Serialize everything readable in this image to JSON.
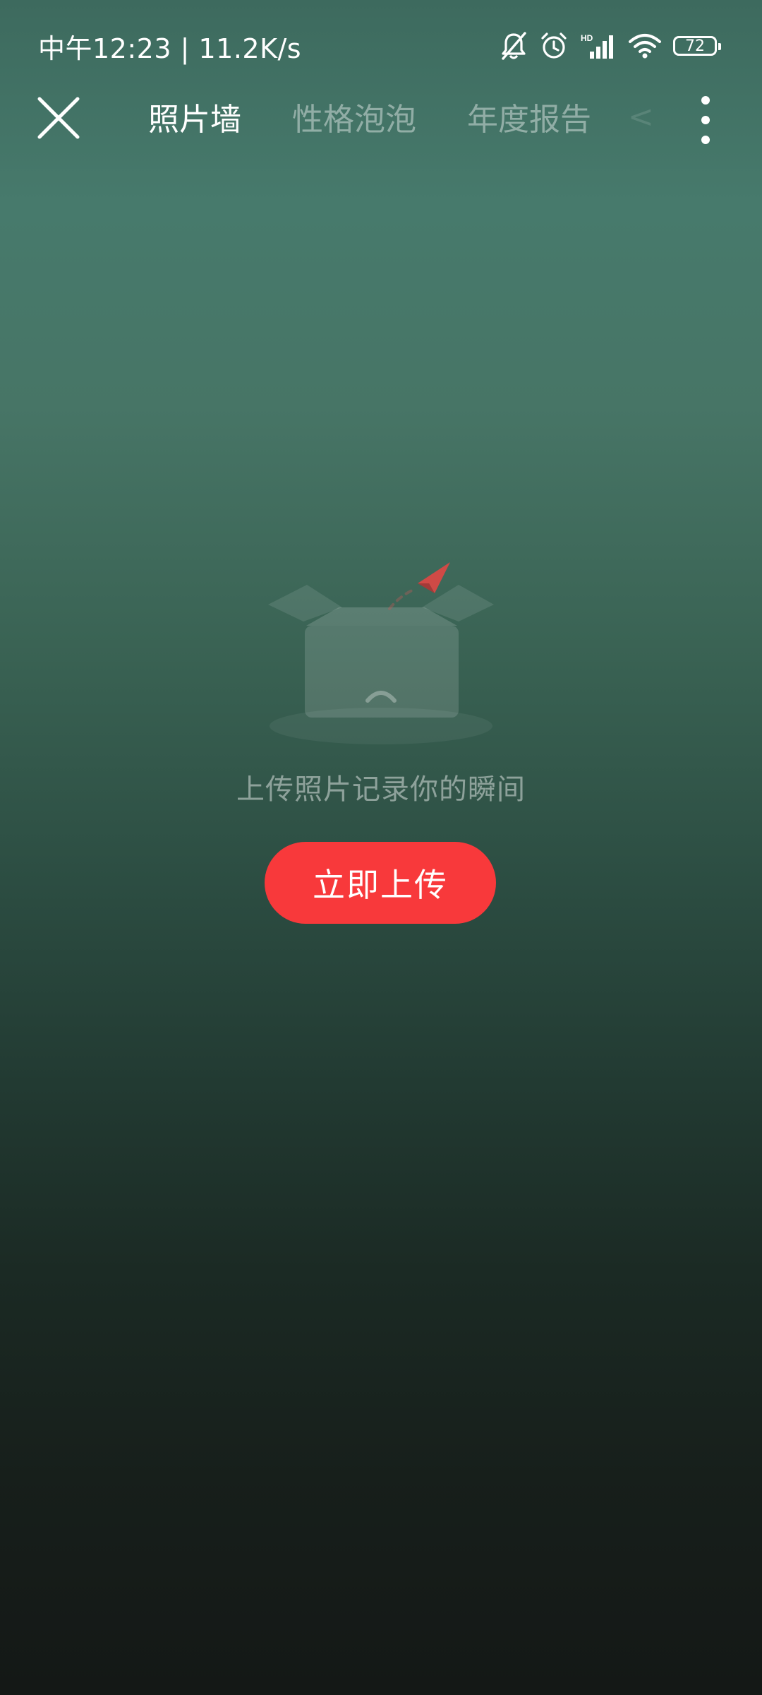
{
  "status_bar": {
    "time_speed": "中午12:23 | 11.2K/s",
    "network_label": "HD",
    "battery_level": "72",
    "icons": [
      "bell-muted-icon",
      "alarm-icon",
      "signal-icon",
      "wifi-icon",
      "battery-icon"
    ]
  },
  "nav": {
    "tabs": [
      {
        "label": "照片墙",
        "active": true
      },
      {
        "label": "性格泡泡",
        "active": false
      },
      {
        "label": "年度报告",
        "active": false
      }
    ],
    "overflow_tab_hint": "<",
    "icons": [
      "close-icon",
      "more-vertical-icon"
    ]
  },
  "empty_state": {
    "message": "上传照片记录你的瞬间",
    "illustration": "empty-box-with-paper-plane-icon",
    "button_label": "立即上传",
    "button_color": "#f8393b"
  }
}
